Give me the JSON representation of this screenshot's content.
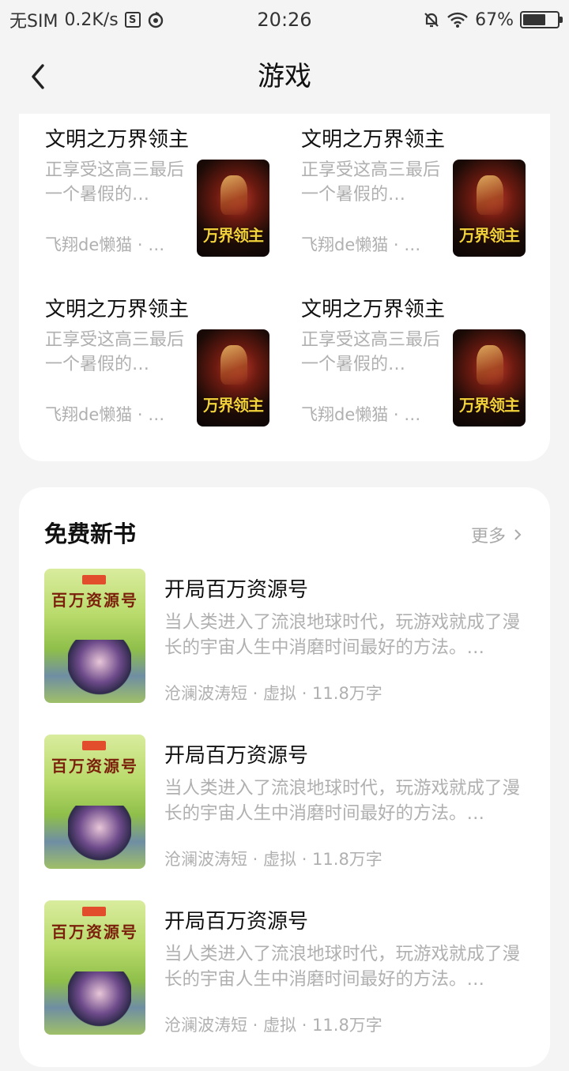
{
  "status_bar": {
    "carrier": "无SIM",
    "speed": "0.2K/s",
    "time": "20:26",
    "battery": "67%",
    "battery_level": 0.67
  },
  "nav": {
    "title": "游戏"
  },
  "grid_books": [
    {
      "title": "文明之万界领主",
      "desc": "正享受这高三最后一个暑假的…",
      "author": "飞翔de懒猫 · …",
      "cover_text": "万界领主"
    },
    {
      "title": "文明之万界领主",
      "desc": "正享受这高三最后一个暑假的…",
      "author": "飞翔de懒猫 · …",
      "cover_text": "万界领主"
    },
    {
      "title": "文明之万界领主",
      "desc": "正享受这高三最后一个暑假的…",
      "author": "飞翔de懒猫 · …",
      "cover_text": "万界领主"
    },
    {
      "title": "文明之万界领主",
      "desc": "正享受这高三最后一个暑假的…",
      "author": "飞翔de懒猫 · …",
      "cover_text": "万界领主"
    }
  ],
  "free_section": {
    "title": "免费新书",
    "more_label": "更多",
    "items": [
      {
        "title": "开局百万资源号",
        "desc": "当人类进入了流浪地球时代，玩游戏就成了漫长的宇宙人生中消磨时间最好的方法。…",
        "meta": "沧澜波涛短 · 虚拟 · 11.8万字",
        "cover_text": "百万资源号"
      },
      {
        "title": "开局百万资源号",
        "desc": "当人类进入了流浪地球时代，玩游戏就成了漫长的宇宙人生中消磨时间最好的方法。…",
        "meta": "沧澜波涛短 · 虚拟 · 11.8万字",
        "cover_text": "百万资源号"
      },
      {
        "title": "开局百万资源号",
        "desc": "当人类进入了流浪地球时代，玩游戏就成了漫长的宇宙人生中消磨时间最好的方法。…",
        "meta": "沧澜波涛短 · 虚拟 · 11.8万字",
        "cover_text": "百万资源号"
      }
    ]
  }
}
